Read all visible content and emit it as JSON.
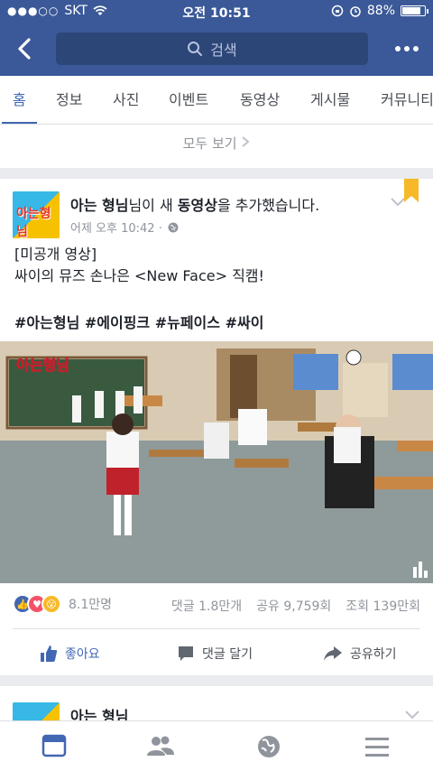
{
  "status": {
    "carrier": "SKT",
    "time": "오전 10:51",
    "battery": "88%",
    "battery_level": 0.88
  },
  "nav": {
    "search_placeholder": "검색"
  },
  "tabs": [
    "홈",
    "정보",
    "사진",
    "이벤트",
    "동영상",
    "게시물",
    "커뮤니티"
  ],
  "see_all": "모두 보기",
  "post": {
    "page_name": "아는 형님",
    "headline_mid": "님이 새 ",
    "headline_bold2": "동영상",
    "headline_tail": "을 추가했습니다.",
    "time": "어제 오후 10:42 ·",
    "line1": "[미공개 영상]",
    "line2": "싸이의 뮤즈 손나은 <New Face> 직캠!",
    "hashtags": "#아는형님 #에이핑크 #뉴페이스 #싸이",
    "video_logo": "아는형님",
    "reactions_count": "8.1만명",
    "comments": "댓글 1.8만개",
    "shares": "공유 9,759회",
    "views": "조회 139만회",
    "like_label": "좋아요",
    "comment_label": "댓글 달기",
    "share_label": "공유하기",
    "accent": "#4267b2"
  },
  "post2": {
    "page_name": "아는 형님"
  }
}
